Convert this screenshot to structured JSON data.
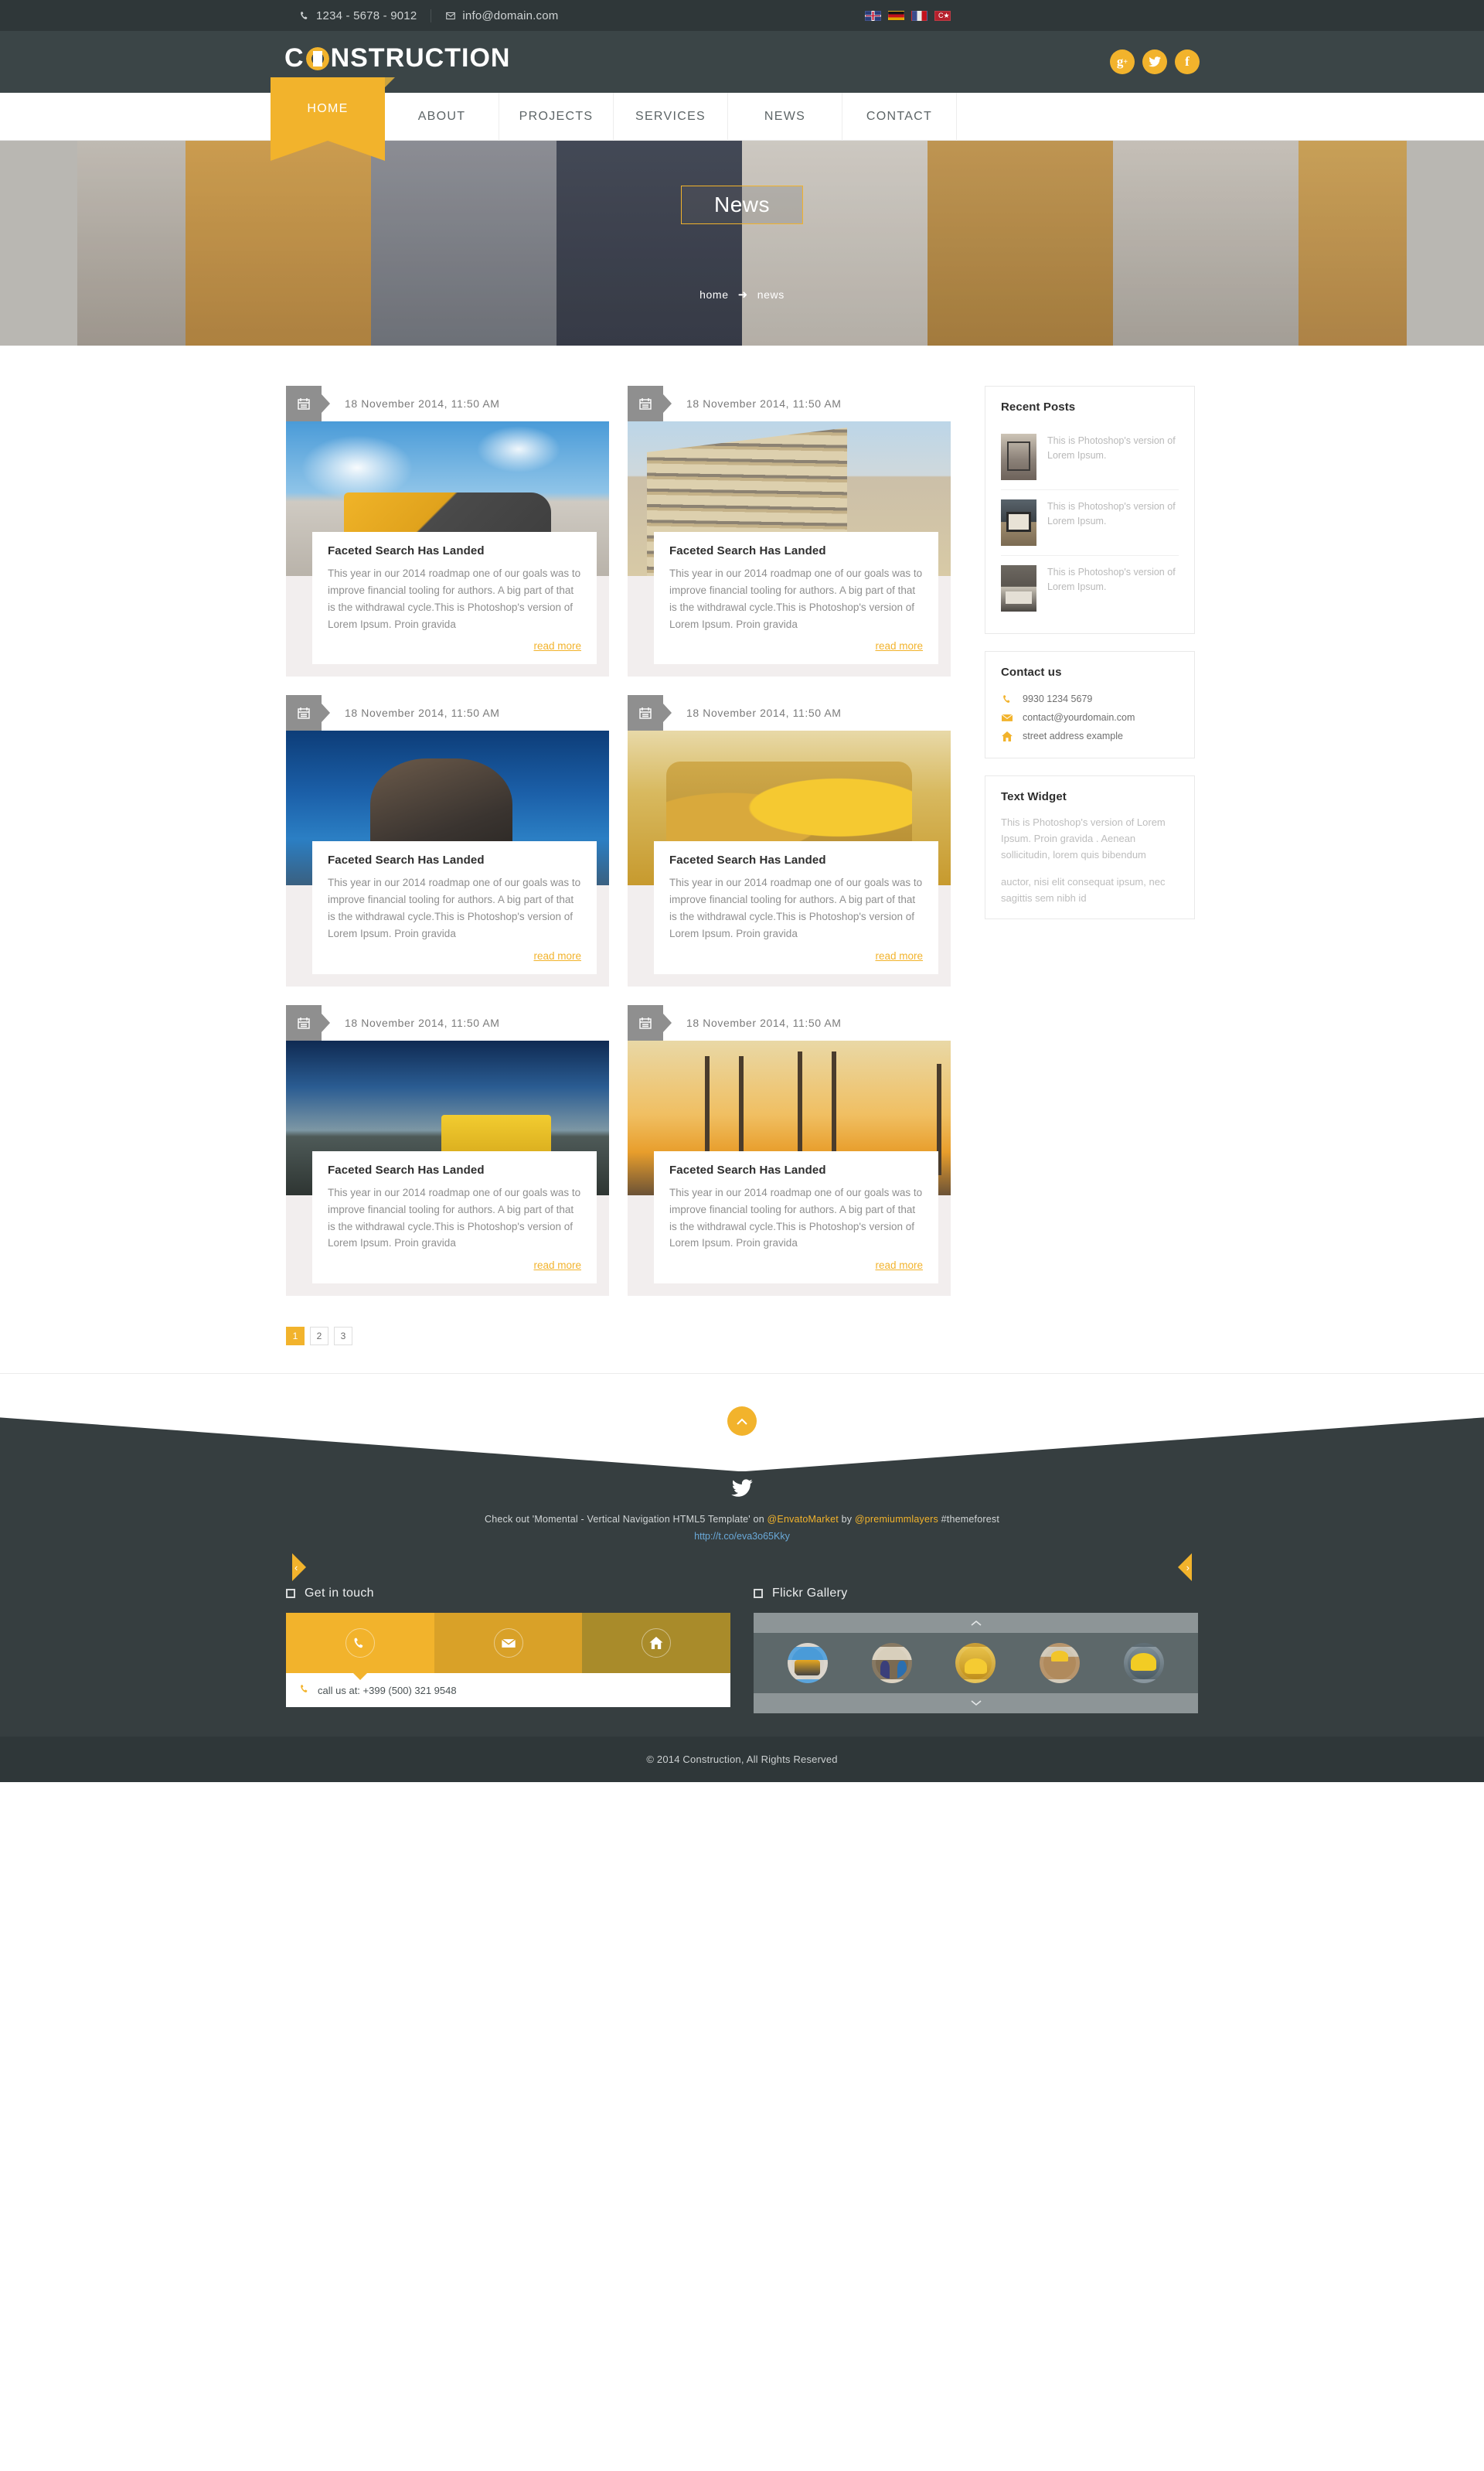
{
  "topbar": {
    "phone": "1234 - 5678 - 9012",
    "email": "info@domain.com",
    "phone_icon": "phone-icon",
    "email_icon": "envelope-icon",
    "languages": [
      {
        "name": "flag-uk",
        "label": "English"
      },
      {
        "name": "flag-de",
        "label": "German"
      },
      {
        "name": "flag-fr",
        "label": "French"
      },
      {
        "name": "flag-tr",
        "label": "Turkish"
      }
    ]
  },
  "header": {
    "logo_part1": "C",
    "logo_part2": "NSTRUCTION",
    "socials": [
      {
        "name": "google-plus-icon",
        "glyph": "g+"
      },
      {
        "name": "twitter-icon",
        "glyph": "🐦"
      },
      {
        "name": "facebook-icon",
        "glyph": "f"
      }
    ]
  },
  "nav": {
    "items": [
      {
        "label": "HOME",
        "active": true
      },
      {
        "label": "ABOUT",
        "active": false
      },
      {
        "label": "PROJECTS",
        "active": false
      },
      {
        "label": "SERVICES",
        "active": false
      },
      {
        "label": "NEWS",
        "active": false
      },
      {
        "label": "CONTACT",
        "active": false
      }
    ]
  },
  "banner": {
    "title": "News",
    "crumb_home": "home",
    "crumb_arrow": "➜",
    "crumb_current": "news"
  },
  "posts": [
    {
      "date": "18 November 2014, 11:50 AM",
      "title": "Faceted Search Has Landed",
      "excerpt": "This year in our 2014 roadmap one of our goals was to improve financial tooling for authors. A big part of that is the withdrawal cycle.This is Photoshop's version  of Lorem Ipsum. Proin gravida",
      "read_more": "read more",
      "image": "wheel-loader-photo"
    },
    {
      "date": "18 November 2014, 11:50 AM",
      "title": "Faceted Search Has Landed",
      "excerpt": "This year in our 2014 roadmap one of our goals was to improve financial tooling for authors. A big part of that is the withdrawal cycle.This is Photoshop's version  of Lorem Ipsum. Proin gravida",
      "read_more": "read more",
      "image": "construction-site-photo"
    },
    {
      "date": "18 November 2014, 11:50 AM",
      "title": "Faceted Search Has Landed",
      "excerpt": "This year in our 2014 roadmap one of our goals was to improve financial tooling for authors. A big part of that is the withdrawal cycle.This is Photoshop's version  of Lorem Ipsum. Proin gravida",
      "read_more": "read more",
      "image": "welder-worker-photo"
    },
    {
      "date": "18 November 2014, 11:50 AM",
      "title": "Faceted Search Has Landed",
      "excerpt": "This year in our 2014 roadmap one of our goals was to improve financial tooling for authors. A big part of that is the withdrawal cycle.This is Photoshop's version  of Lorem Ipsum. Proin gravida",
      "read_more": "read more",
      "image": "boots-helmet-photo"
    },
    {
      "date": "18 November 2014, 11:50 AM",
      "title": "Faceted Search Has Landed",
      "excerpt": "This year in our 2014 roadmap one of our goals was to improve financial tooling for authors. A big part of that is the withdrawal cycle.This is Photoshop's version  of Lorem Ipsum. Proin gravida",
      "read_more": "read more",
      "image": "road-roller-photo"
    },
    {
      "date": "18 November 2014, 11:50 AM",
      "title": "Faceted Search Has Landed",
      "excerpt": "This year in our 2014 roadmap one of our goals was to improve financial tooling for authors. A big part of that is the withdrawal cycle.This is Photoshop's version  of Lorem Ipsum. Proin gravida",
      "read_more": "read more",
      "image": "bridge-sunset-photo"
    }
  ],
  "sidebar": {
    "recent_posts": {
      "title": "Recent Posts",
      "items": [
        {
          "text": "This is Photoshop's version  of Lorem Ipsum.",
          "thumb": "bedroom-thumb"
        },
        {
          "text": "This is Photoshop's version  of Lorem Ipsum.",
          "thumb": "fireplace-thumb"
        },
        {
          "text": "This is Photoshop's version  of Lorem Ipsum.",
          "thumb": "livingroom-thumb"
        }
      ]
    },
    "contact": {
      "title": "Contact us",
      "rows": [
        {
          "icon": "phone-icon",
          "text": "9930 1234 5679"
        },
        {
          "icon": "envelope-icon",
          "text": "contact@yourdomain.com"
        },
        {
          "icon": "home-icon",
          "text": "street address example"
        }
      ]
    },
    "text_widget": {
      "title": "Text Widget",
      "paragraph1": "This is Photoshop's version  of Lorem Ipsum. Proin gravida . Aenean sollicitudin, lorem quis bibendum",
      "paragraph2": "auctor, nisi elit consequat ipsum, nec sagittis sem nibh id"
    }
  },
  "pagination": {
    "pages": [
      {
        "label": "1",
        "active": true
      },
      {
        "label": "2",
        "active": false
      },
      {
        "label": "3",
        "active": false
      }
    ]
  },
  "footer": {
    "to_top_icon": "chevron-up-icon",
    "twitter_icon": "twitter-bird-icon",
    "tweet_prefix": "Check out 'Momental - Vertical Navigation HTML5 Template' on ",
    "tweet_handle1": "@EnvatoMarket",
    "tweet_mid": " by ",
    "tweet_handle2": "@premiummlayers",
    "tweet_suffix": " #themeforest",
    "tweet_url": "http://t.co/eva3o65Kky",
    "prev_arrow": "‹",
    "next_arrow": "›",
    "get_in_touch": {
      "title": "Get in touch",
      "tabs": [
        {
          "icon": "phone-icon",
          "name": "phone-tab"
        },
        {
          "icon": "envelope-icon",
          "name": "email-tab"
        },
        {
          "icon": "home-icon",
          "name": "address-tab"
        }
      ],
      "body_icon": "phone-icon",
      "body_text": "call us at: +399 (500) 321 9548"
    },
    "flickr": {
      "title": "Flickr Gallery",
      "up_icon": "chevron-up-icon",
      "down_icon": "chevron-down-icon",
      "thumbs": [
        {
          "name": "loader-thumb"
        },
        {
          "name": "engineers-thumb"
        },
        {
          "name": "helmet-thumb"
        },
        {
          "name": "worker-thumb"
        },
        {
          "name": "hardhat-thumb"
        }
      ]
    },
    "copyright": "© 2014 Construction, All Rights Reserved"
  }
}
